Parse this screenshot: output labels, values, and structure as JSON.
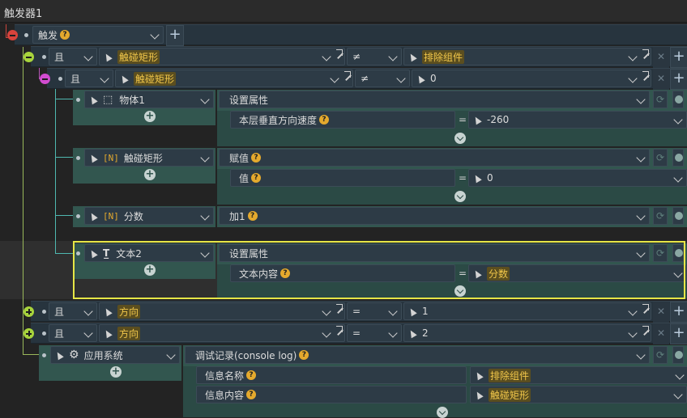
{
  "title": "触发器1",
  "trigger": {
    "label": "触发"
  },
  "conditions": [
    {
      "logic": "且",
      "left": "触碰矩形",
      "op": "≠",
      "right": "排除组件",
      "right_hl": true
    },
    {
      "logic": "且",
      "left": "触碰矩形",
      "op": "≠",
      "right": "0",
      "right_hl": false
    }
  ],
  "actions": [
    {
      "target": "物体1",
      "action": "设置属性",
      "param_label": "本层垂直方向速度",
      "eq": "=",
      "param_value": "-260",
      "value_hl": false
    },
    {
      "target": "触碰矩形",
      "action": "赋值",
      "param_label": "值",
      "eq": "=",
      "param_value": "0",
      "value_hl": false
    },
    {
      "target": "分数",
      "action": "加1"
    },
    {
      "target": "文本2",
      "action": "设置属性",
      "param_label": "文本内容",
      "eq": "=",
      "param_value": "分数",
      "value_hl": true
    }
  ],
  "conditions2": [
    {
      "logic": "且",
      "left": "方向",
      "op": "=",
      "right": "1"
    },
    {
      "logic": "且",
      "left": "方向",
      "op": "=",
      "right": "2"
    }
  ],
  "system": {
    "target": "应用系统",
    "action": "调试记录(console log)",
    "params": [
      {
        "label": "信息名称",
        "eq": "=",
        "value": "排除组件"
      },
      {
        "label": "信息内容",
        "eq": "=",
        "value": "触碰矩形"
      }
    ]
  },
  "icons": {
    "cursor": "cursor-icon",
    "cube": "cube-icon",
    "number": "[N]",
    "text": "text-icon",
    "gear": "gear-icon"
  },
  "colors": {
    "trigger_node": "#d8433c",
    "and_node": "#a8d43c",
    "and_node2": "#d24cd0",
    "highlight": "#e6e646",
    "accent": "#f0c64a"
  }
}
